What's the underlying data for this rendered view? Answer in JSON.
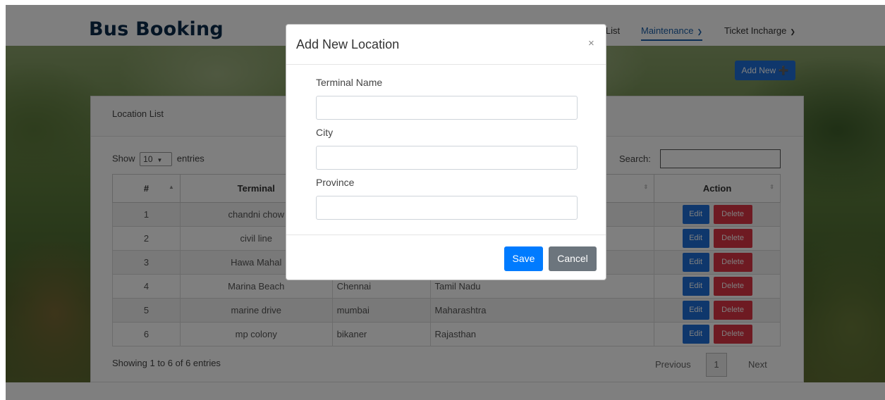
{
  "brand": "Bus Booking",
  "nav": {
    "partial_link": "d List",
    "maintenance": "Maintenance",
    "ticket_incharge": "Ticket Incharge"
  },
  "add_new_label": "Add New ➕",
  "card": {
    "title": "Location List",
    "show_prefix": "Show",
    "show_value": "10",
    "show_suffix": "entries",
    "search_label": "Search:",
    "search_value": ""
  },
  "table": {
    "columns": [
      "#",
      "Terminal",
      "",
      "",
      "Action"
    ],
    "rows": [
      {
        "num": "1",
        "terminal": "chandni chow",
        "city": "",
        "province": ""
      },
      {
        "num": "2",
        "terminal": "civil line",
        "city": "",
        "province": ""
      },
      {
        "num": "3",
        "terminal": "Hawa Mahal",
        "city": "",
        "province": ""
      },
      {
        "num": "4",
        "terminal": "Marina Beach",
        "city": "Chennai",
        "province": "Tamil Nadu"
      },
      {
        "num": "5",
        "terminal": "marine drive",
        "city": "mumbai",
        "province": "Maharashtra"
      },
      {
        "num": "6",
        "terminal": "mp colony",
        "city": "bikaner",
        "province": "Rajasthan"
      }
    ],
    "edit_label": "Edit",
    "delete_label": "Delete"
  },
  "footer": {
    "info": "Showing 1 to 6 of 6 entries",
    "previous": "Previous",
    "page": "1",
    "next": "Next"
  },
  "modal": {
    "title": "Add New Location",
    "close": "×",
    "terminal_label": "Terminal Name",
    "terminal_value": "",
    "city_label": "City",
    "city_value": "",
    "province_label": "Province",
    "province_value": "",
    "save_label": "Save",
    "cancel_label": "Cancel"
  },
  "colors": {
    "primary": "#007bff",
    "danger": "#dc3545",
    "secondary": "#6c757d",
    "brand": "#0b2b4a"
  }
}
